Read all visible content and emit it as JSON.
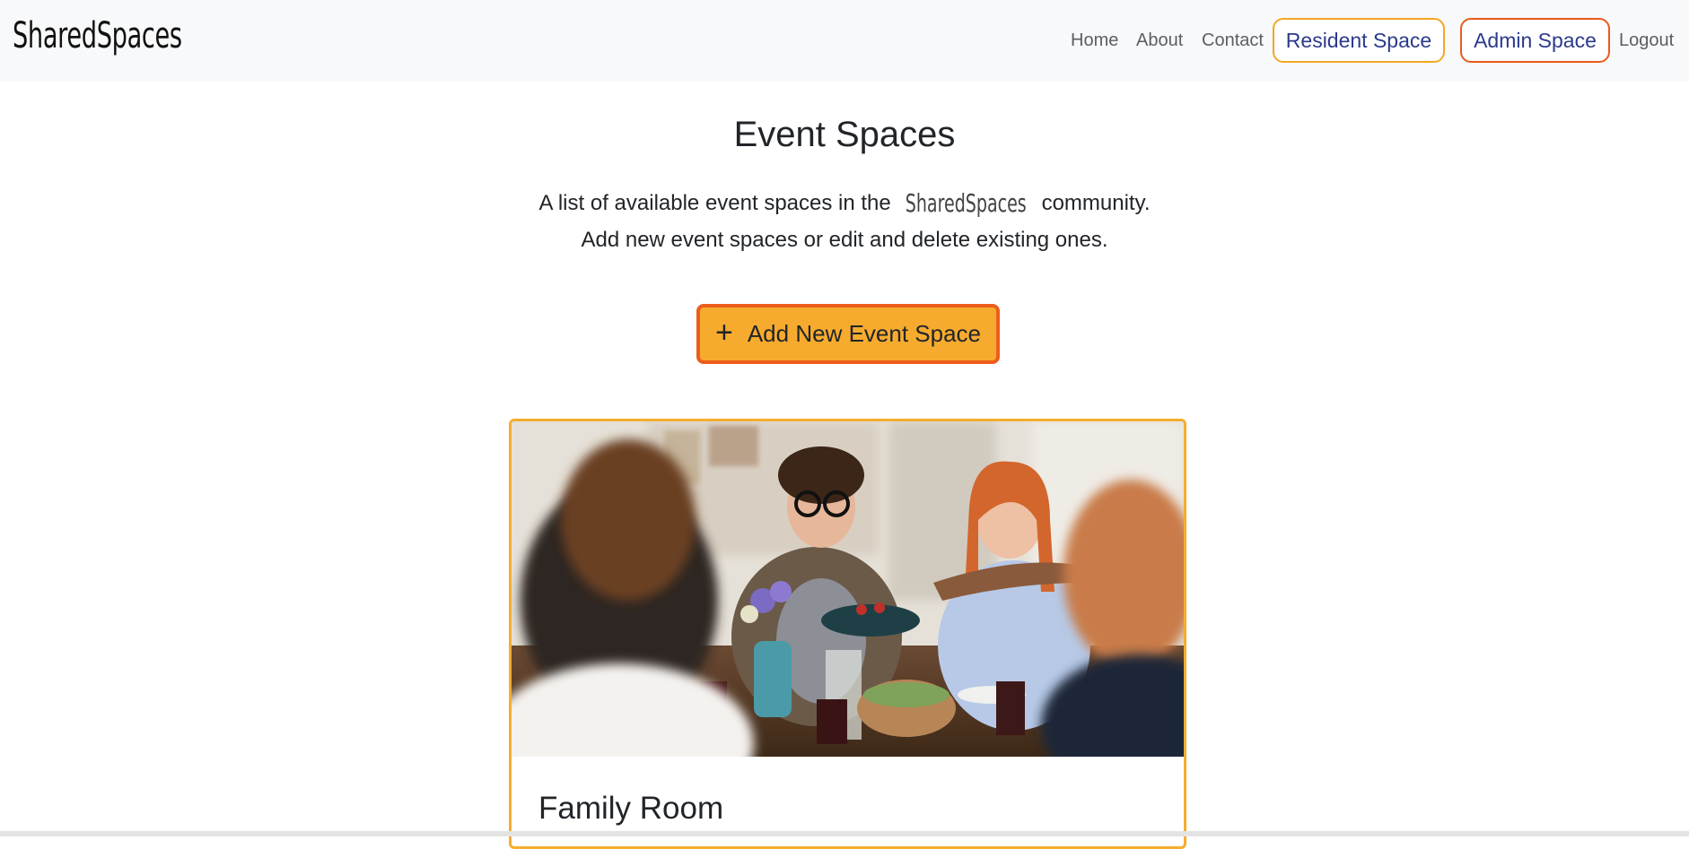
{
  "nav": {
    "brand": "SharedSpaces",
    "links": {
      "home": "Home",
      "about": "About",
      "contact": "Contact",
      "logout": "Logout"
    },
    "resident_space": "Resident Space",
    "admin_space": "Admin Space"
  },
  "main": {
    "title": "Event Spaces",
    "intro_before_brand": "A list of available event spaces in the ",
    "intro_brand": "SharedSpaces",
    "intro_after_brand": " community.",
    "intro_line2": "Add new event spaces or edit and delete existing ones.",
    "add_button_icon": "+",
    "add_button_label": "Add New Event Space"
  },
  "cards": [
    {
      "title": "Family Room",
      "image": "people-dining-photo"
    }
  ],
  "colors": {
    "accent_orange": "#f7ab2e",
    "accent_red_orange": "#ec5d1c",
    "nav_link_blue": "#2b3a8c",
    "navbar_bg": "#f8f9fa"
  }
}
